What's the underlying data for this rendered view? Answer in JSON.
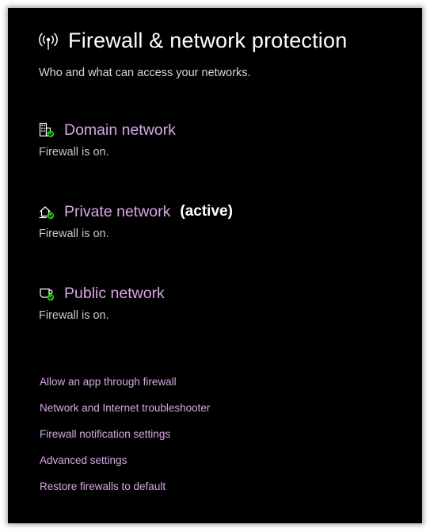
{
  "header": {
    "title": "Firewall & network protection",
    "subtitle": "Who and what can access your networks.",
    "icon": "antenna-broadcast-icon"
  },
  "networks": [
    {
      "title": "Domain network",
      "active_label": "",
      "status": "Firewall is on.",
      "icon": "building-icon"
    },
    {
      "title": "Private network",
      "active_label": "(active)",
      "status": "Firewall is on.",
      "icon": "home-network-icon"
    },
    {
      "title": "Public network",
      "active_label": "",
      "status": "Firewall is on.",
      "icon": "coffee-cup-icon"
    }
  ],
  "links": [
    "Allow an app through firewall",
    "Network and Internet troubleshooter",
    "Firewall notification settings",
    "Advanced settings",
    "Restore firewalls to default"
  ],
  "colors": {
    "background": "#000000",
    "accent_link": "#d9a6e5",
    "status_check": "#16c60c"
  }
}
